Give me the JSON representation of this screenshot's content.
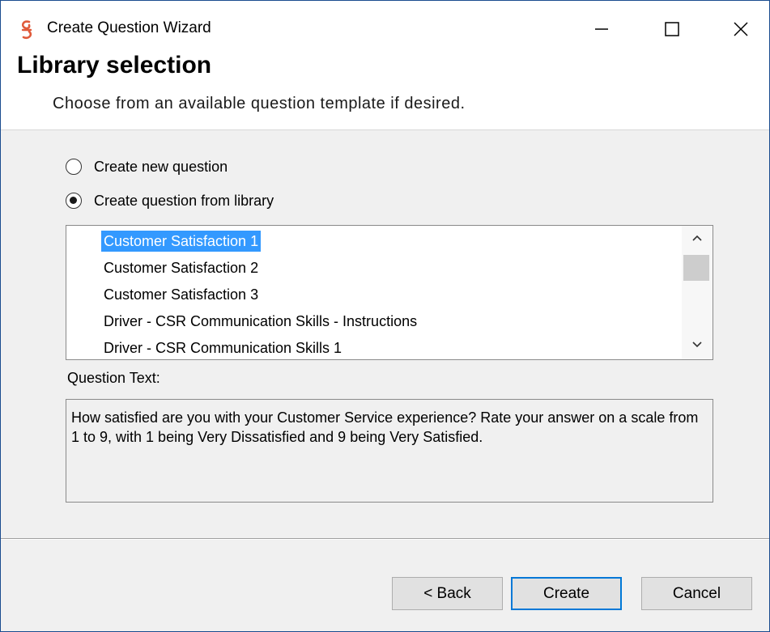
{
  "window": {
    "title": "Create Question Wizard",
    "accent_color": "#1a4c8f",
    "icon": "app-logo-icon",
    "controls": {
      "minimize": "minimize-icon",
      "maximize": "maximize-icon",
      "close": "close-icon"
    }
  },
  "header": {
    "title": "Library selection",
    "subtitle": "Choose from an available question template if desired."
  },
  "options": {
    "new_question": {
      "label": "Create new question",
      "selected": false
    },
    "from_library": {
      "label": "Create question from library",
      "selected": true
    }
  },
  "library": {
    "selected_index": 0,
    "selection_color": "#3399ff",
    "items": [
      "Customer Satisfaction 1",
      "Customer Satisfaction 2",
      "Customer Satisfaction 3",
      "Driver - CSR Communication Skills - Instructions",
      "Driver - CSR Communication Skills 1"
    ]
  },
  "question_text": {
    "label": "Question Text:",
    "value": "How satisfied are you with your Customer Service experience? Rate your answer on a scale from 1 to 9, with 1 being Very Dissatisfied and 9 being Very Satisfied."
  },
  "buttons": {
    "back": "< Back",
    "create": "Create",
    "cancel": "Cancel",
    "default_button_border": "#0078d7"
  }
}
